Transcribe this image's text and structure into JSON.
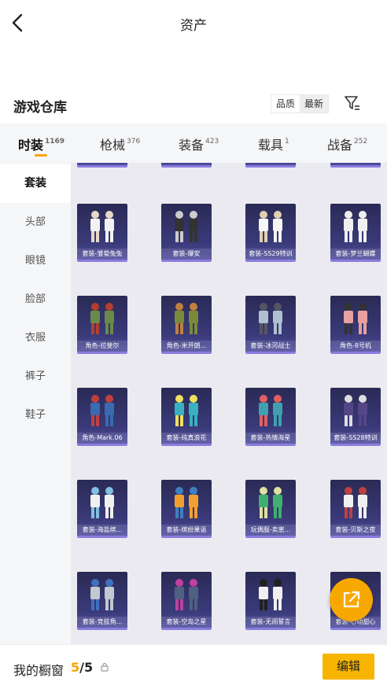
{
  "header": {
    "title": "资产"
  },
  "warehouse": {
    "title": "游戏仓库",
    "sort": [
      "品质",
      "最新"
    ]
  },
  "tabs": [
    {
      "label": "时装",
      "count": "1169"
    },
    {
      "label": "枪械",
      "count": "376"
    },
    {
      "label": "装备",
      "count": "423"
    },
    {
      "label": "载具",
      "count": "1"
    },
    {
      "label": "战备",
      "count": "252"
    }
  ],
  "sidebar": {
    "items": [
      "套装",
      "头部",
      "眼镜",
      "脸部",
      "衣服",
      "裤子",
      "鞋子"
    ]
  },
  "items": [
    "套装-雏菊兔兔",
    "套装-爆安",
    "套装-SS29特训",
    "套装-梦兰蝴蝶",
    "角色-拉斐尔",
    "角色-米开朗...",
    "套装-冰河战士",
    "角色-8号机",
    "角色-Mark.06",
    "套装-纯真浪花",
    "套装-热情海星",
    "套装-SS28特训",
    "套装-海盐缤...",
    "套装-缤纷果语",
    "玩偶服-卖崽...",
    "套装-贝斯之夜",
    "套装-竞技角...",
    "套装-空岛之星",
    "套装-无闹誓言",
    "套装-心动甜心"
  ],
  "bottom": {
    "label": "我的橱窗",
    "current": "5",
    "total": "/5",
    "edit": "编辑"
  },
  "colors": {
    "accent": "#f5a400",
    "card": "#3a3a7a"
  },
  "icons": {
    "back": "chevron-left-icon",
    "filter": "filter-icon",
    "share": "external-link-icon",
    "lock": "lock-icon"
  }
}
